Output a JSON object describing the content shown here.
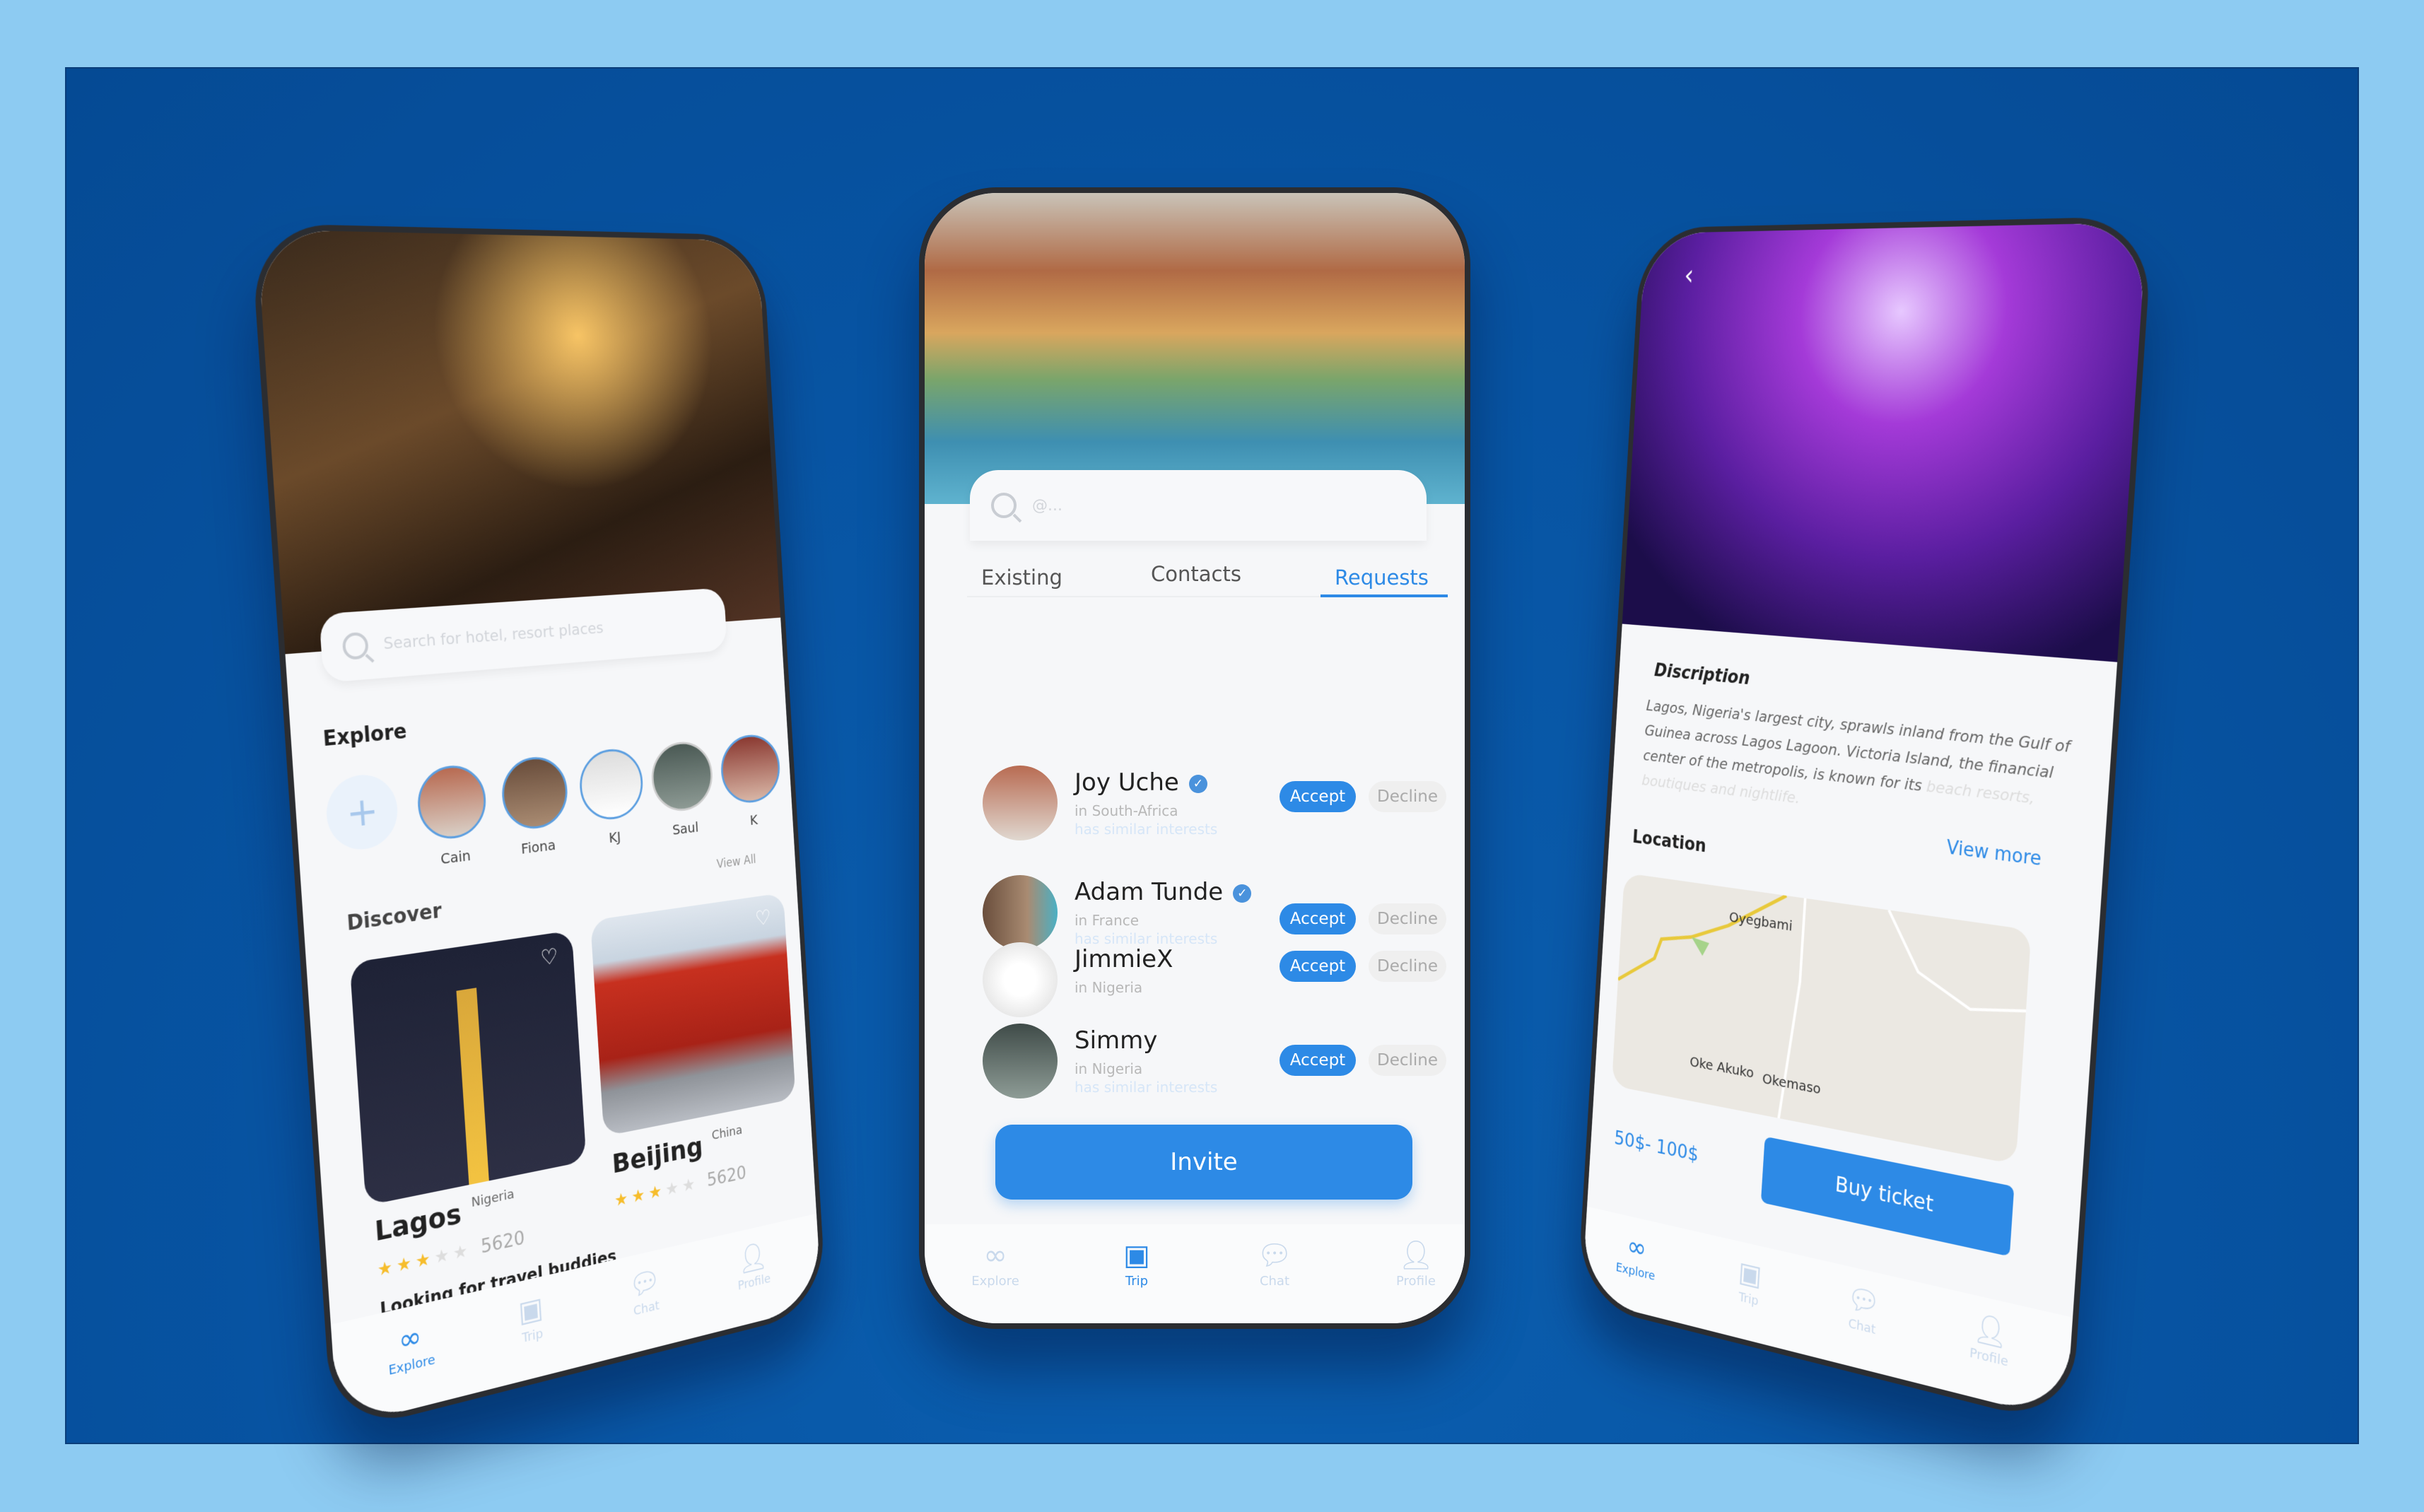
{
  "colors": {
    "accent": "#2d8ae6",
    "page_bg": "#8dcbf2",
    "stage_bg": "#0754a3"
  },
  "left_phone": {
    "search_placeholder": "Search for hotel, resort places",
    "explore_title": "Explore",
    "add_icon": "plus-icon",
    "stories": [
      {
        "name": "Cain"
      },
      {
        "name": "Fiona"
      },
      {
        "name": "KJ"
      },
      {
        "name": "Saul"
      },
      {
        "name": "K"
      }
    ],
    "discover_title": "Discover",
    "view_all": "View All",
    "cards": [
      {
        "city": "Lagos",
        "country": "Nigeria",
        "rating": 3,
        "max_rating": 5,
        "count": "5620"
      },
      {
        "city": "Beijing",
        "country": "China",
        "rating": 3,
        "max_rating": 5,
        "count": "5620"
      }
    ],
    "buddies_title": "Looking for travel buddies",
    "nav": [
      {
        "label": "Explore",
        "icon": "binoculars-icon",
        "active": true
      },
      {
        "label": "Trip",
        "icon": "calendar-icon"
      },
      {
        "label": "Chat",
        "icon": "chat-icon"
      },
      {
        "label": "Profile",
        "icon": "user-icon"
      }
    ]
  },
  "center_phone": {
    "search_placeholder": "@...",
    "tabs": [
      {
        "label": "Existing"
      },
      {
        "label": "Contacts"
      },
      {
        "label": "Requests",
        "active": true
      }
    ],
    "requests": [
      {
        "name": "Joy Uche",
        "verified": true,
        "location": "in South-Africa",
        "note": "has similar interests"
      },
      {
        "name": "Adam Tunde",
        "verified": true,
        "location": "in France",
        "note": "has similar interests"
      },
      {
        "name": "JimmieX",
        "verified": false,
        "location": "in Nigeria",
        "note": ""
      },
      {
        "name": "Simmy",
        "verified": false,
        "location": "in Nigeria",
        "note": "has similar interests"
      }
    ],
    "accept_label": "Accept",
    "decline_label": "Decline",
    "invite_label": "Invite",
    "nav": [
      {
        "label": "Explore",
        "icon": "binoculars-icon"
      },
      {
        "label": "Trip",
        "icon": "calendar-icon",
        "active": true
      },
      {
        "label": "Chat",
        "icon": "chat-icon"
      },
      {
        "label": "Profile",
        "icon": "user-icon"
      }
    ]
  },
  "right_phone": {
    "description_title": "Discription",
    "description": "Lagos, Nigeria's largest city, sprawls inland from the Gulf of Guinea across Lagos Lagoon. Victoria Island, the financial center of the metropolis, is known for its",
    "description_faded": "beach resorts, boutiques and nightlife.",
    "view_more": "View more",
    "location_title": "Location",
    "map_labels": {
      "a": "Oyegbami",
      "b": "Oke Akuko",
      "c": "Okemaso"
    },
    "price": "50$- 100$",
    "buy_label": "Buy ticket",
    "nav": [
      {
        "label": "Explore",
        "icon": "binoculars-icon",
        "active": true
      },
      {
        "label": "Trip",
        "icon": "calendar-icon"
      },
      {
        "label": "Chat",
        "icon": "chat-icon"
      },
      {
        "label": "Profile",
        "icon": "user-icon"
      }
    ]
  }
}
